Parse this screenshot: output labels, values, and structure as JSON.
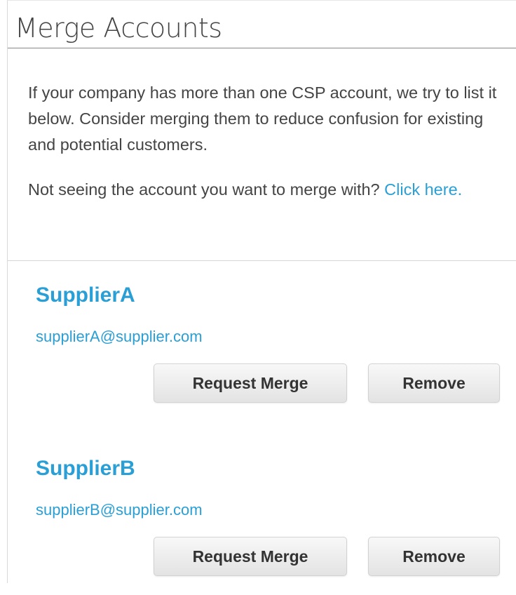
{
  "header": {
    "title": "Merge Accounts"
  },
  "intro": {
    "text": "If your company has more than one CSP account, we try to list it below. Consider merging them to reduce confusion for existing and potential customers.",
    "prompt_text": "Not seeing the account you want to merge with?",
    "prompt_link": "Click here."
  },
  "accounts": [
    {
      "name": "SupplierA",
      "email": "supplierA@supplier.com",
      "merge_label": "Request Merge",
      "remove_label": "Remove"
    },
    {
      "name": "SupplierB",
      "email": "supplierB@supplier.com",
      "merge_label": "Request Merge",
      "remove_label": "Remove"
    }
  ],
  "colors": {
    "link": "#2a9fd6",
    "text": "#444444",
    "button_bg": "#eeeeee"
  }
}
